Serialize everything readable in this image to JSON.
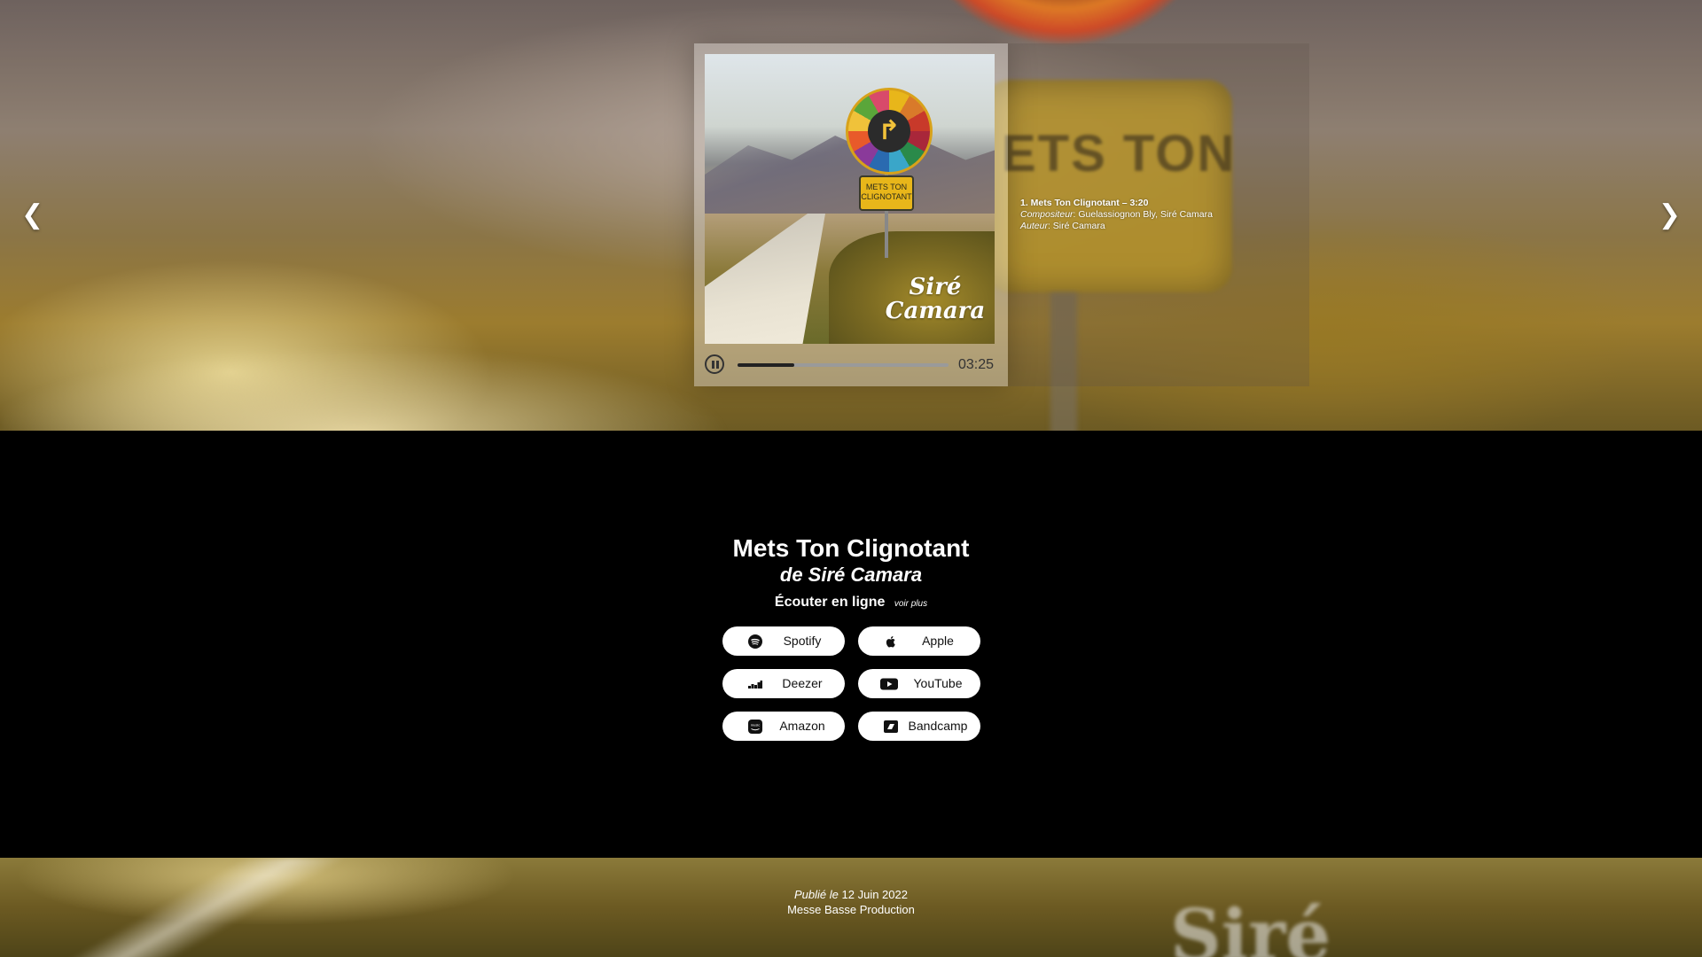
{
  "nav": {
    "prev": "❮",
    "next": "❯"
  },
  "cover": {
    "sign_plate": "METS TON CLIGNOTANT",
    "artist_line1": "Siré",
    "artist_line2": "Camara",
    "arrow_glyph": "↱"
  },
  "player": {
    "time": "03:25",
    "progress": 0.27,
    "state": "playing"
  },
  "track": {
    "title": "1. Mets Ton Clignotant – 3:20",
    "composer_label": "Compositeur",
    "composer": "Guelassiognon Bly, Siré Camara",
    "author_label": "Auteur",
    "author": "Siré Camara"
  },
  "album": {
    "title": "Mets Ton Clignotant",
    "artist": "de Siré Camara"
  },
  "listen": {
    "label": "Écouter en ligne",
    "see_more": "voir plus"
  },
  "platforms": [
    {
      "label": "Spotify",
      "icon": "spotify-icon"
    },
    {
      "label": "Apple",
      "icon": "apple-icon"
    },
    {
      "label": "Deezer",
      "icon": "deezer-icon"
    },
    {
      "label": "YouTube",
      "icon": "youtube-icon"
    },
    {
      "label": "Amazon",
      "icon": "amazon-music-icon"
    },
    {
      "label": "Bandcamp",
      "icon": "bandcamp-icon"
    }
  ],
  "footer": {
    "published_label": "Publié le",
    "date": "12 Juin 2022",
    "label": "Messe Basse Production",
    "bg_text": "Siré"
  }
}
